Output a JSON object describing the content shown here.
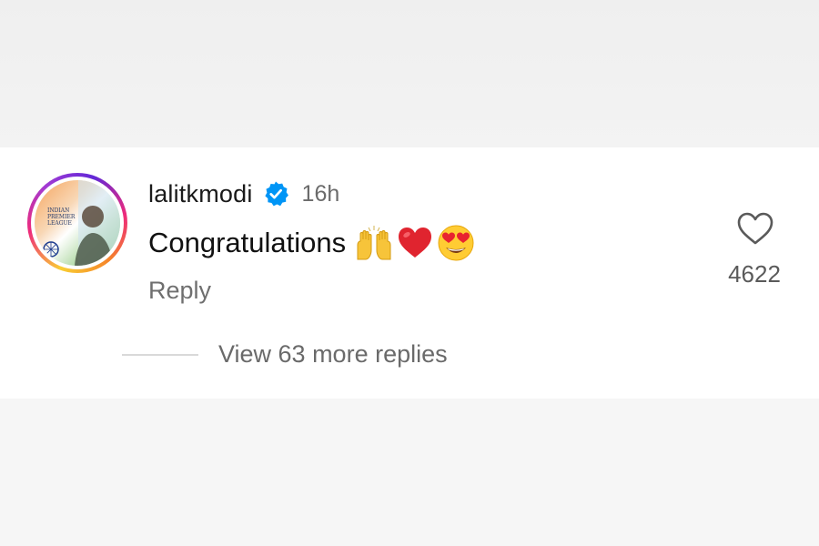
{
  "comment": {
    "username": "lalitkmodi",
    "verified": true,
    "time_ago": "16h",
    "text": "Congratulations",
    "emojis": [
      "raising-hands",
      "red-heart",
      "heart-eyes"
    ],
    "reply_label": "Reply",
    "like_count": "4622",
    "view_more_label": "View 63 more replies",
    "avatar_text": "INDIAN PREMIER LEAGUE"
  },
  "colors": {
    "verified_blue": "#0095f6",
    "text_primary": "#111111",
    "text_secondary": "#6b6b6b",
    "card_bg": "#ffffff",
    "page_bg": "#f3f3f3"
  },
  "icons": {
    "verified": "verified-badge-icon",
    "like": "heart-outline-icon"
  }
}
